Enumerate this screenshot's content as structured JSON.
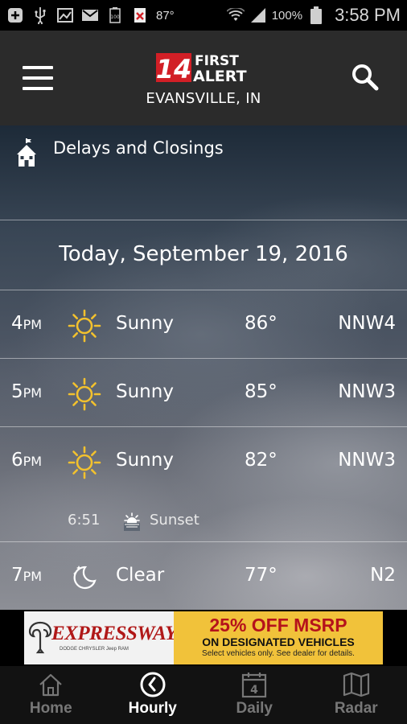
{
  "status_bar": {
    "temperature": "87°",
    "battery": "100%",
    "time": "3:58 PM"
  },
  "header": {
    "logo_number": "14",
    "logo_line1": "FIRST",
    "logo_line2": "ALERT",
    "location": "EVANSVILLE, IN",
    "icons": [
      "menu-icon",
      "search-icon"
    ]
  },
  "delays": {
    "label": "Delays and Closings",
    "icon": "school-icon"
  },
  "date_label": "Today, September 19, 2016",
  "hourly": [
    {
      "hour": "4",
      "ampm": "PM",
      "condition": "Sunny",
      "temp": "86°",
      "wind": "NNW4",
      "icon": "sun-icon"
    },
    {
      "hour": "5",
      "ampm": "PM",
      "condition": "Sunny",
      "temp": "85°",
      "wind": "NNW3",
      "icon": "sun-icon"
    },
    {
      "hour": "6",
      "ampm": "PM",
      "condition": "Sunny",
      "temp": "82°",
      "wind": "NNW3",
      "icon": "sun-icon"
    },
    {
      "hour": "7",
      "ampm": "PM",
      "condition": "Clear",
      "temp": "77°",
      "wind": "N2",
      "icon": "moon-icon"
    }
  ],
  "sunset": {
    "time": "6:51",
    "label": "Sunset"
  },
  "ad": {
    "brand": "EXPRESSWAY",
    "brand_sub": "DODGE CHRYSLER Jeep RAM",
    "headline": "25% OFF MSRP",
    "line2": "ON DESIGNATED VEHICLES",
    "line3": "Select vehicles only. See dealer for details."
  },
  "nav": {
    "tabs": [
      {
        "label": "Home",
        "icon": "home-icon",
        "active": false
      },
      {
        "label": "Hourly",
        "icon": "clock-icon",
        "active": true
      },
      {
        "label": "Daily",
        "icon": "calendar-icon",
        "badge": "4",
        "active": false
      },
      {
        "label": "Radar",
        "icon": "map-icon",
        "active": false
      }
    ]
  },
  "colors": {
    "header_bg": "#2b2b2b",
    "logo_red": "#d21f26",
    "sun_yellow": "#f2c12e",
    "nav_active": "#ffffff",
    "nav_inactive": "#777777",
    "ad_yellow": "#f1c23a"
  }
}
